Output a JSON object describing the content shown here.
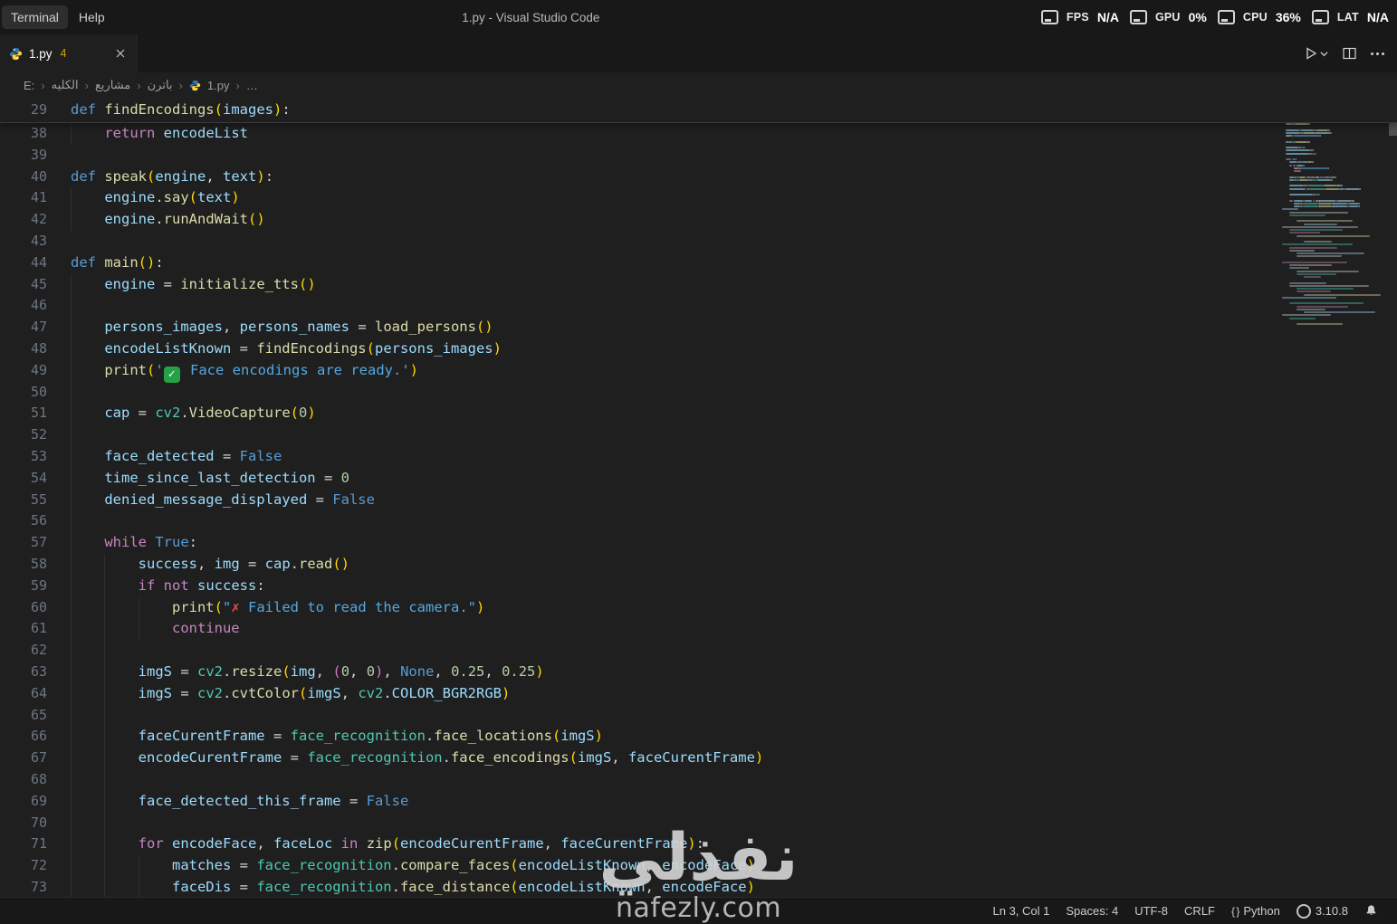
{
  "window": {
    "title": "1.py - Visual Studio Code",
    "menus": [
      "Terminal",
      "Help"
    ]
  },
  "perf": {
    "metrics": [
      {
        "label": "FPS",
        "value": "N/A",
        "icon": "fps-icon"
      },
      {
        "label": "GPU",
        "value": "0%",
        "icon": "gpu-icon"
      },
      {
        "label": "CPU",
        "value": "36%",
        "icon": "cpu-icon"
      },
      {
        "label": "LAT",
        "value": "N/A",
        "icon": "lat-icon"
      }
    ]
  },
  "tab": {
    "label": "1.py",
    "badge": "4"
  },
  "breadcrumb": {
    "separator": "›",
    "items": [
      "E:",
      "الكليه",
      "مشاريع",
      "باترن",
      "1.py",
      "…"
    ],
    "file_item_index": 4
  },
  "editor": {
    "sticky": {
      "n": 29,
      "g": 0,
      "t": [
        [
          "d",
          "def "
        ],
        [
          "f",
          "findEncodings"
        ],
        [
          "b1",
          "("
        ],
        [
          "v",
          "images"
        ],
        [
          "b1",
          ")"
        ],
        [
          "p",
          ":"
        ]
      ]
    },
    "lines": [
      {
        "n": 38,
        "g": 1,
        "t": [
          [
            "p",
            "    "
          ],
          [
            "k",
            "return"
          ],
          [
            "p",
            " "
          ],
          [
            "v",
            "encodeList"
          ]
        ]
      },
      {
        "n": 39,
        "g": 0,
        "t": []
      },
      {
        "n": 40,
        "g": 0,
        "t": [
          [
            "d",
            "def "
          ],
          [
            "f",
            "speak"
          ],
          [
            "b1",
            "("
          ],
          [
            "v",
            "engine"
          ],
          [
            "p",
            ", "
          ],
          [
            "v",
            "text"
          ],
          [
            "b1",
            ")"
          ],
          [
            "p",
            ":"
          ]
        ]
      },
      {
        "n": 41,
        "g": 1,
        "t": [
          [
            "p",
            "    "
          ],
          [
            "v",
            "engine"
          ],
          [
            "p",
            "."
          ],
          [
            "f",
            "say"
          ],
          [
            "b1",
            "("
          ],
          [
            "v",
            "text"
          ],
          [
            "b1",
            ")"
          ]
        ]
      },
      {
        "n": 42,
        "g": 1,
        "t": [
          [
            "p",
            "    "
          ],
          [
            "v",
            "engine"
          ],
          [
            "p",
            "."
          ],
          [
            "f",
            "runAndWait"
          ],
          [
            "b1",
            "()"
          ]
        ]
      },
      {
        "n": 43,
        "g": 0,
        "t": []
      },
      {
        "n": 44,
        "g": 0,
        "t": [
          [
            "d",
            "def "
          ],
          [
            "f",
            "main"
          ],
          [
            "b1",
            "()"
          ],
          [
            "p",
            ":"
          ]
        ]
      },
      {
        "n": 45,
        "g": 1,
        "t": [
          [
            "p",
            "    "
          ],
          [
            "v",
            "engine"
          ],
          [
            "p",
            " = "
          ],
          [
            "f",
            "initialize_tts"
          ],
          [
            "b1",
            "()"
          ]
        ]
      },
      {
        "n": 46,
        "g": 1,
        "t": []
      },
      {
        "n": 47,
        "g": 1,
        "t": [
          [
            "p",
            "    "
          ],
          [
            "v",
            "persons_images"
          ],
          [
            "p",
            ", "
          ],
          [
            "v",
            "persons_names"
          ],
          [
            "p",
            " = "
          ],
          [
            "f",
            "load_persons"
          ],
          [
            "b1",
            "()"
          ]
        ]
      },
      {
        "n": 48,
        "g": 1,
        "t": [
          [
            "p",
            "    "
          ],
          [
            "v",
            "encodeListKnown"
          ],
          [
            "p",
            " = "
          ],
          [
            "f",
            "findEncodings"
          ],
          [
            "b1",
            "("
          ],
          [
            "v",
            "persons_images"
          ],
          [
            "b1",
            ")"
          ]
        ]
      },
      {
        "n": 49,
        "g": 1,
        "t": [
          [
            "p",
            "    "
          ],
          [
            "f",
            "print"
          ],
          [
            "b1",
            "("
          ],
          [
            "s",
            "'"
          ],
          [
            "ec",
            "✓"
          ],
          [
            "s",
            " Face encodings are ready.'"
          ],
          [
            "b1",
            ")"
          ]
        ]
      },
      {
        "n": 50,
        "g": 1,
        "t": []
      },
      {
        "n": 51,
        "g": 1,
        "t": [
          [
            "p",
            "    "
          ],
          [
            "v",
            "cap"
          ],
          [
            "p",
            " = "
          ],
          [
            "c",
            "cv2"
          ],
          [
            "p",
            "."
          ],
          [
            "f",
            "VideoCapture"
          ],
          [
            "b1",
            "("
          ],
          [
            "n",
            "0"
          ],
          [
            "b1",
            ")"
          ]
        ]
      },
      {
        "n": 52,
        "g": 1,
        "t": []
      },
      {
        "n": 53,
        "g": 1,
        "t": [
          [
            "p",
            "    "
          ],
          [
            "v",
            "face_detected"
          ],
          [
            "p",
            " = "
          ],
          [
            "d",
            "False"
          ]
        ]
      },
      {
        "n": 54,
        "g": 1,
        "t": [
          [
            "p",
            "    "
          ],
          [
            "v",
            "time_since_last_detection"
          ],
          [
            "p",
            " = "
          ],
          [
            "n",
            "0"
          ]
        ]
      },
      {
        "n": 55,
        "g": 1,
        "t": [
          [
            "p",
            "    "
          ],
          [
            "v",
            "denied_message_displayed"
          ],
          [
            "p",
            " = "
          ],
          [
            "d",
            "False"
          ]
        ]
      },
      {
        "n": 56,
        "g": 1,
        "t": []
      },
      {
        "n": 57,
        "g": 1,
        "t": [
          [
            "p",
            "    "
          ],
          [
            "k",
            "while"
          ],
          [
            "p",
            " "
          ],
          [
            "d",
            "True"
          ],
          [
            "p",
            ":"
          ]
        ]
      },
      {
        "n": 58,
        "g": 2,
        "t": [
          [
            "p",
            "        "
          ],
          [
            "v",
            "success"
          ],
          [
            "p",
            ", "
          ],
          [
            "v",
            "img"
          ],
          [
            "p",
            " = "
          ],
          [
            "v",
            "cap"
          ],
          [
            "p",
            "."
          ],
          [
            "f",
            "read"
          ],
          [
            "b1",
            "()"
          ]
        ]
      },
      {
        "n": 59,
        "g": 2,
        "t": [
          [
            "p",
            "        "
          ],
          [
            "k",
            "if"
          ],
          [
            "p",
            " "
          ],
          [
            "k",
            "not"
          ],
          [
            "p",
            " "
          ],
          [
            "v",
            "success"
          ],
          [
            "p",
            ":"
          ]
        ]
      },
      {
        "n": 60,
        "g": 3,
        "t": [
          [
            "p",
            "            "
          ],
          [
            "f",
            "print"
          ],
          [
            "b1",
            "("
          ],
          [
            "s",
            "\""
          ],
          [
            "ex",
            "✗"
          ],
          [
            "s",
            " Failed to read the camera.\""
          ],
          [
            "b1",
            ")"
          ]
        ]
      },
      {
        "n": 61,
        "g": 3,
        "t": [
          [
            "p",
            "            "
          ],
          [
            "k",
            "continue"
          ]
        ]
      },
      {
        "n": 62,
        "g": 2,
        "t": []
      },
      {
        "n": 63,
        "g": 2,
        "t": [
          [
            "p",
            "        "
          ],
          [
            "v",
            "imgS"
          ],
          [
            "p",
            " = "
          ],
          [
            "c",
            "cv2"
          ],
          [
            "p",
            "."
          ],
          [
            "f",
            "resize"
          ],
          [
            "b1",
            "("
          ],
          [
            "v",
            "img"
          ],
          [
            "p",
            ", "
          ],
          [
            "b2",
            "("
          ],
          [
            "n",
            "0"
          ],
          [
            "p",
            ", "
          ],
          [
            "n",
            "0"
          ],
          [
            "b2",
            ")"
          ],
          [
            "p",
            ", "
          ],
          [
            "d",
            "None"
          ],
          [
            "p",
            ", "
          ],
          [
            "n",
            "0.25"
          ],
          [
            "p",
            ", "
          ],
          [
            "n",
            "0.25"
          ],
          [
            "b1",
            ")"
          ]
        ]
      },
      {
        "n": 64,
        "g": 2,
        "t": [
          [
            "p",
            "        "
          ],
          [
            "v",
            "imgS"
          ],
          [
            "p",
            " = "
          ],
          [
            "c",
            "cv2"
          ],
          [
            "p",
            "."
          ],
          [
            "f",
            "cvtColor"
          ],
          [
            "b1",
            "("
          ],
          [
            "v",
            "imgS"
          ],
          [
            "p",
            ", "
          ],
          [
            "c",
            "cv2"
          ],
          [
            "p",
            "."
          ],
          [
            "v",
            "COLOR_BGR2RGB"
          ],
          [
            "b1",
            ")"
          ]
        ]
      },
      {
        "n": 65,
        "g": 2,
        "t": []
      },
      {
        "n": 66,
        "g": 2,
        "t": [
          [
            "p",
            "        "
          ],
          [
            "v",
            "faceCurentFrame"
          ],
          [
            "p",
            " = "
          ],
          [
            "c",
            "face_recognition"
          ],
          [
            "p",
            "."
          ],
          [
            "f",
            "face_locations"
          ],
          [
            "b1",
            "("
          ],
          [
            "v",
            "imgS"
          ],
          [
            "b1",
            ")"
          ]
        ]
      },
      {
        "n": 67,
        "g": 2,
        "t": [
          [
            "p",
            "        "
          ],
          [
            "v",
            "encodeCurentFrame"
          ],
          [
            "p",
            " = "
          ],
          [
            "c",
            "face_recognition"
          ],
          [
            "p",
            "."
          ],
          [
            "f",
            "face_encodings"
          ],
          [
            "b1",
            "("
          ],
          [
            "v",
            "imgS"
          ],
          [
            "p",
            ", "
          ],
          [
            "v",
            "faceCurentFrame"
          ],
          [
            "b1",
            ")"
          ]
        ]
      },
      {
        "n": 68,
        "g": 2,
        "t": []
      },
      {
        "n": 69,
        "g": 2,
        "t": [
          [
            "p",
            "        "
          ],
          [
            "v",
            "face_detected_this_frame"
          ],
          [
            "p",
            " = "
          ],
          [
            "d",
            "False"
          ]
        ]
      },
      {
        "n": 70,
        "g": 2,
        "t": []
      },
      {
        "n": 71,
        "g": 2,
        "t": [
          [
            "p",
            "        "
          ],
          [
            "k",
            "for"
          ],
          [
            "p",
            " "
          ],
          [
            "v",
            "encodeFace"
          ],
          [
            "p",
            ", "
          ],
          [
            "v",
            "faceLoc"
          ],
          [
            "p",
            " "
          ],
          [
            "k",
            "in"
          ],
          [
            "p",
            " "
          ],
          [
            "f",
            "zip"
          ],
          [
            "b1",
            "("
          ],
          [
            "v",
            "encodeCurentFrame"
          ],
          [
            "p",
            ", "
          ],
          [
            "v",
            "faceCurentFrame"
          ],
          [
            "b1",
            ")"
          ],
          [
            "p",
            ":"
          ]
        ]
      },
      {
        "n": 72,
        "g": 3,
        "t": [
          [
            "p",
            "            "
          ],
          [
            "v",
            "matches"
          ],
          [
            "p",
            " = "
          ],
          [
            "c",
            "face_recognition"
          ],
          [
            "p",
            "."
          ],
          [
            "f",
            "compare_faces"
          ],
          [
            "b1",
            "("
          ],
          [
            "v",
            "encodeListKnown"
          ],
          [
            "p",
            ", "
          ],
          [
            "v",
            "encodeFace"
          ],
          [
            "b1",
            ")"
          ]
        ]
      },
      {
        "n": 73,
        "g": 3,
        "t": [
          [
            "p",
            "            "
          ],
          [
            "v",
            "faceDis"
          ],
          [
            "p",
            " = "
          ],
          [
            "c",
            "face_recognition"
          ],
          [
            "p",
            "."
          ],
          [
            "f",
            "face_distance"
          ],
          [
            "b1",
            "("
          ],
          [
            "v",
            "encodeListKnown"
          ],
          [
            "p",
            ", "
          ],
          [
            "v",
            "encodeFace"
          ],
          [
            "b1",
            ")"
          ]
        ]
      }
    ]
  },
  "minimap": {
    "highlight_rows": 4,
    "extra_rows": 40,
    "highlight_color": "#d7ba7d"
  },
  "statusbar": {
    "cursor": "Ln 3, Col 1",
    "indentation": "Spaces: 4",
    "encoding": "UTF-8",
    "eol": "CRLF",
    "language_icon": "{ }",
    "language": "Python",
    "interpreter": "3.10.8"
  },
  "watermark": {
    "title": "نفذلي",
    "domain": "nafezly.com"
  },
  "colors": {
    "background": "#1f1f1f",
    "chrome": "#181818",
    "keyword": "#C586C0",
    "storage_keyword": "#569CD6",
    "function": "#DCDCAA",
    "variable": "#9CDCFE",
    "string": "#55A8E2",
    "number": "#B5CEA8",
    "module": "#4EC9B0",
    "bracket": "#FFD700",
    "warning_badge": "#CCA700",
    "check_emoji": "#26A148",
    "cross_emoji": "#F14C4C"
  }
}
